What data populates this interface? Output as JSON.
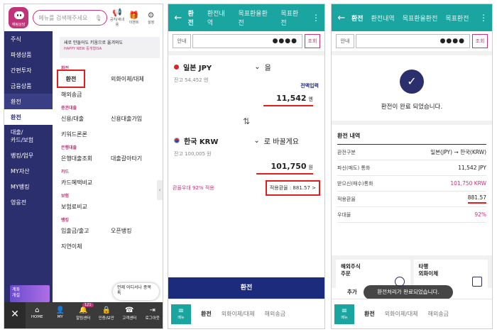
{
  "panel1": {
    "avatar_label": "예림상담",
    "search_placeholder": "메뉴를 검색해주세요",
    "top_icons": [
      {
        "icon": "megaphone-icon",
        "label": "공지/새내용"
      },
      {
        "icon": "gift-icon",
        "label": "이벤트"
      },
      {
        "icon": "gear-icon",
        "label": "설정"
      }
    ],
    "sidebar": [
      "주식",
      "파생상품",
      "간편투자",
      "금융상품",
      "환전",
      "환전",
      "대출/\n카드/보험",
      "뱅킹/업무",
      "MY자산",
      "MY뱅킹",
      "영웅전"
    ],
    "account_open": "계좌\n개설",
    "banner_title": "새로 만들어도 키움으로 옮겨와도",
    "banner_sub": "HAPPY NEW 중개형ISA",
    "sections": [
      {
        "title": "환전",
        "rows": [
          [
            "환전",
            "외화이체/대체"
          ],
          [
            "해외송금",
            ""
          ]
        ]
      },
      {
        "title": "증권대출",
        "rows": [
          [
            "신용/대출",
            "신용대출가입"
          ],
          [
            "키워드론론",
            ""
          ]
        ]
      },
      {
        "title": "은행대출",
        "rows": [
          [
            "은행대출조회",
            "대출갈아타기"
          ]
        ]
      },
      {
        "title": "카드",
        "rows": [
          [
            "카드혜택비교",
            ""
          ]
        ]
      },
      {
        "title": "보험",
        "rows": [
          [
            "보험료비교",
            ""
          ]
        ]
      },
      {
        "title": "뱅킹",
        "rows": [
          [
            "입출금/출고",
            "오픈뱅킹"
          ],
          [
            "지연이체",
            ""
          ]
        ]
      }
    ],
    "float_text": "언제 어디서나 종목톡",
    "bottom": [
      {
        "icon": "home-icon",
        "label": "HOME"
      },
      {
        "icon": "person-icon",
        "label": "MY"
      },
      {
        "icon": "bell-icon",
        "label": "알림센터",
        "badge": "121"
      },
      {
        "icon": "lock-icon",
        "label": "인증/보안"
      },
      {
        "icon": "headset-icon",
        "label": "고객센터"
      },
      {
        "icon": "logout-icon",
        "label": "로그아웃"
      }
    ]
  },
  "panel2": {
    "tabs": [
      "환전",
      "환전내역",
      "목표환율환전",
      "목표환전"
    ],
    "acct_label": "안내",
    "acct_mask": "●●●●",
    "acct_btn": "조회",
    "from_currency": "일본 JPY",
    "from_suffix": "을",
    "from_balance": "잔고 54,452 엔",
    "full_amount": "전액입력",
    "from_amount": "11,542",
    "from_unit": "엔",
    "to_currency": "한국 KRW",
    "to_suffix": "로 바꿀게요",
    "to_balance": "잔고 100,005 원",
    "to_amount": "101,750",
    "to_unit": "원",
    "rate_note": "환율우대 92% 적용",
    "rate_box": "적용환율 : 881.57 >",
    "exchange_btn": "환전",
    "menu_label": "메뉴",
    "subnav": [
      "환전",
      "외화이체/대체",
      "해외송금"
    ]
  },
  "panel3": {
    "tabs": [
      "환전",
      "환전내역",
      "목표환율환전",
      "목표환전"
    ],
    "acct_label": "안내",
    "acct_mask": "●●●●",
    "acct_btn": "조회",
    "done_msg": "환전이 완료 되었습니다.",
    "history_title": "환전 내역",
    "history": [
      {
        "k": "환전구분",
        "v": "일본(JPY) → 한국(KRW)"
      },
      {
        "k": "파신(매도) 통화",
        "v": "11,542 JPY"
      },
      {
        "k": "받으신(매수)통화",
        "v": "101,750 KRW"
      },
      {
        "k": "적용환율",
        "v": "881.57"
      },
      {
        "k": "우대율",
        "v": "92%"
      }
    ],
    "card1": "해외주식\n주문",
    "card2": "타행\n외화이체",
    "add_text": "추가",
    "toast": "환전처리가 완료되었습니다.",
    "menu_label": "메뉴",
    "subnav": [
      "환전",
      "외화이체/대체",
      "해외송금"
    ]
  }
}
